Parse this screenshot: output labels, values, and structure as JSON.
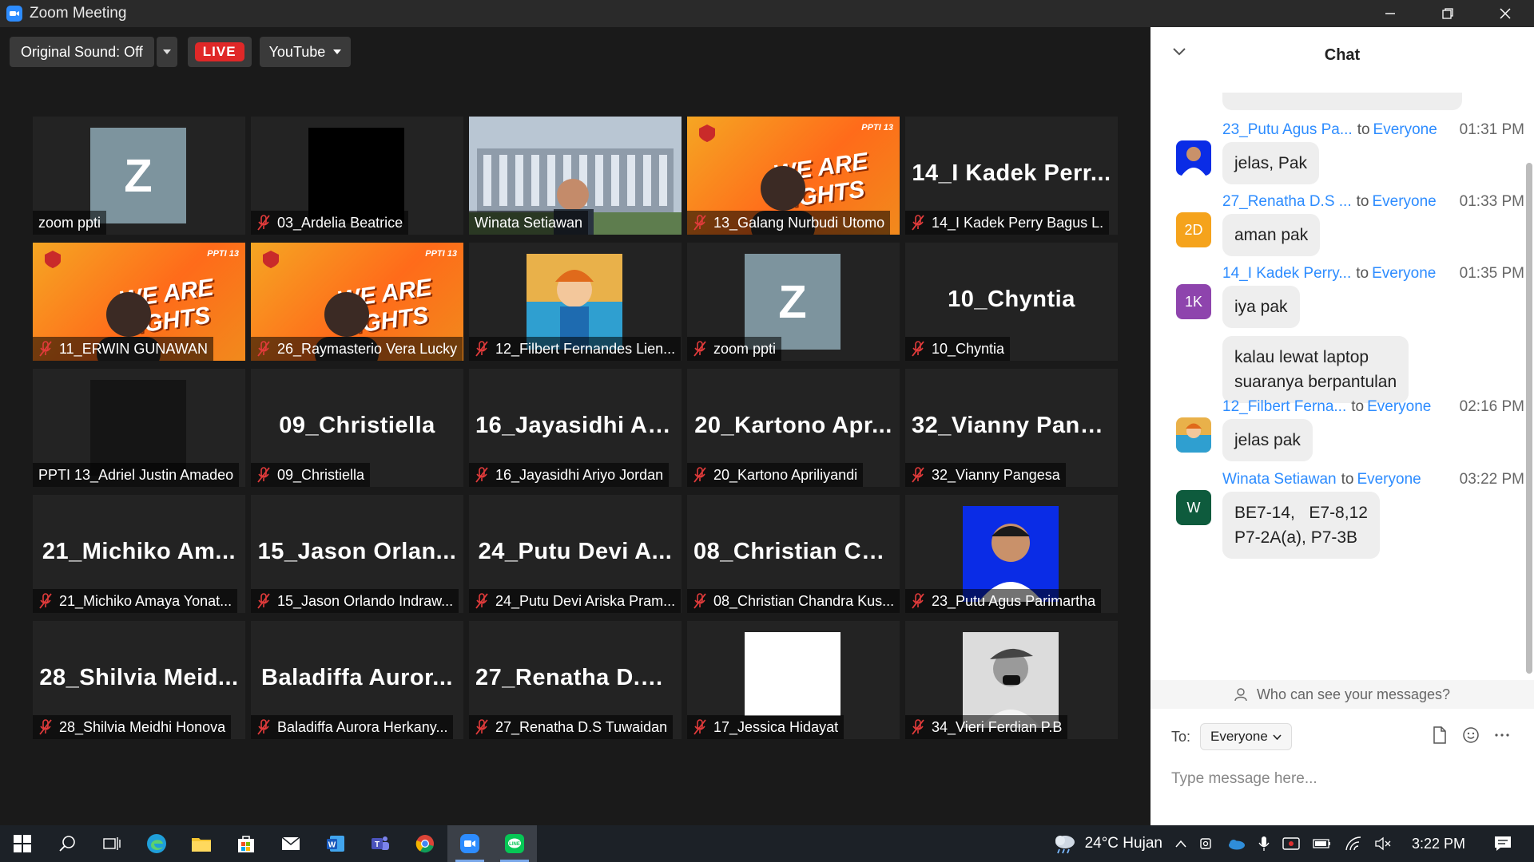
{
  "window": {
    "title": "Zoom Meeting"
  },
  "toolbar": {
    "original_sound": "Original Sound: Off",
    "live": "LIVE",
    "youtube": "YouTube"
  },
  "tiles": [
    {
      "big": "",
      "name": "zoom ppti",
      "muted": false,
      "kind": "z"
    },
    {
      "big": "",
      "name": "03_Ardelia Beatrice",
      "muted": true,
      "kind": "black"
    },
    {
      "big": "",
      "name": "Winata Setiawan",
      "muted": false,
      "kind": "building",
      "active": true
    },
    {
      "big": "",
      "name": "13_Galang Nurbudi Utomo",
      "muted": true,
      "kind": "banner"
    },
    {
      "big": "14_I Kadek Perr...",
      "name": "14_I Kadek Perry Bagus L.",
      "muted": true,
      "kind": "text"
    },
    {
      "big": "",
      "name": "11_ERWIN GUNAWAN",
      "muted": true,
      "kind": "banner"
    },
    {
      "big": "",
      "name": "26_Raymasterio Vera Lucky",
      "muted": true,
      "kind": "banner"
    },
    {
      "big": "",
      "name": "12_Filbert Fernandes Lien...",
      "muted": true,
      "kind": "cartoon"
    },
    {
      "big": "",
      "name": "zoom ppti",
      "muted": true,
      "kind": "z"
    },
    {
      "big": "10_Chyntia",
      "name": "10_Chyntia",
      "muted": true,
      "kind": "text"
    },
    {
      "big": "",
      "name": "PPTI 13_Adriel Justin Amadeo",
      "muted": false,
      "kind": "dark"
    },
    {
      "big": "09_Christiella",
      "name": "09_Christiella",
      "muted": true,
      "kind": "text"
    },
    {
      "big": "16_Jayasidhi Ari...",
      "name": "16_Jayasidhi Ariyo Jordan",
      "muted": true,
      "kind": "text"
    },
    {
      "big": "20_Kartono Apr...",
      "name": "20_Kartono Apriliyandi",
      "muted": true,
      "kind": "text"
    },
    {
      "big": "32_Vianny Pang...",
      "name": "32_Vianny Pangesa",
      "muted": true,
      "kind": "text"
    },
    {
      "big": "21_Michiko Am...",
      "name": "21_Michiko Amaya Yonat...",
      "muted": true,
      "kind": "text"
    },
    {
      "big": "15_Jason Orlan...",
      "name": "15_Jason Orlando Indraw...",
      "muted": true,
      "kind": "text"
    },
    {
      "big": "24_Putu Devi A...",
      "name": "24_Putu Devi Ariska Pram...",
      "muted": true,
      "kind": "text"
    },
    {
      "big": "08_Christian Ch...",
      "name": "08_Christian Chandra Kus...",
      "muted": true,
      "kind": "text"
    },
    {
      "big": "",
      "name": "23_Putu Agus Parimartha",
      "muted": true,
      "kind": "portrait-blue"
    },
    {
      "big": "28_Shilvia Meid...",
      "name": "28_Shilvia Meidhi Honova",
      "muted": true,
      "kind": "text"
    },
    {
      "big": "Baladiffa Auror...",
      "name": "Baladiffa Aurora Herkany...",
      "muted": true,
      "kind": "text"
    },
    {
      "big": "27_Renatha D.S...",
      "name": "27_Renatha D.S Tuwaidan",
      "muted": true,
      "kind": "text"
    },
    {
      "big": "",
      "name": "17_Jessica Hidayat",
      "muted": true,
      "kind": "white"
    },
    {
      "big": "",
      "name": "34_Vieri Ferdian P.B",
      "muted": true,
      "kind": "portrait-bw"
    }
  ],
  "banner": {
    "text": "WE ARE LIGHTS",
    "tag": "PPTI 13"
  },
  "chat": {
    "title": "Chat",
    "messages": [
      {
        "sender": "23_Putu Agus Pa...",
        "to_word": "to",
        "to": "Everyone",
        "time": "01:31 PM",
        "avatar_kind": "photo",
        "avatar_text": "",
        "bubbles": [
          "jelas, Pak"
        ]
      },
      {
        "sender": "27_Renatha D.S ...",
        "to_word": "to",
        "to": "Everyone",
        "time": "01:33 PM",
        "avatar_kind": "initials",
        "avatar_text": "2D",
        "avatar_color": "#f5a31c",
        "bubbles": [
          "aman pak"
        ]
      },
      {
        "sender": "14_I Kadek Perry...",
        "to_word": "to",
        "to": "Everyone",
        "time": "01:35 PM",
        "avatar_kind": "initials",
        "avatar_text": "1K",
        "avatar_color": "#8e44ad",
        "bubbles": [
          "iya pak",
          "kalau lewat laptop\nsuaranya berpantulan"
        ]
      },
      {
        "sender": "12_Filbert Ferna...",
        "to_word": "to",
        "to": "Everyone",
        "time": "02:16 PM",
        "avatar_kind": "cartoon",
        "avatar_text": "",
        "bubbles": [
          "jelas pak"
        ]
      },
      {
        "sender": "Winata Setiawan",
        "to_word": "to",
        "to": "Everyone",
        "time": "03:22 PM",
        "avatar_kind": "initials",
        "avatar_text": "W",
        "avatar_color": "#0e5b3d",
        "bubbles": [
          "BE7-14,   E7-8,12\nP7-2A(a), P7-3B"
        ]
      }
    ],
    "privacy": "Who can see your messages?",
    "to_label": "To:",
    "to_value": "Everyone",
    "placeholder": "Type message here..."
  },
  "taskbar": {
    "weather": "24°C  Hujan",
    "time": "3:22 PM"
  }
}
